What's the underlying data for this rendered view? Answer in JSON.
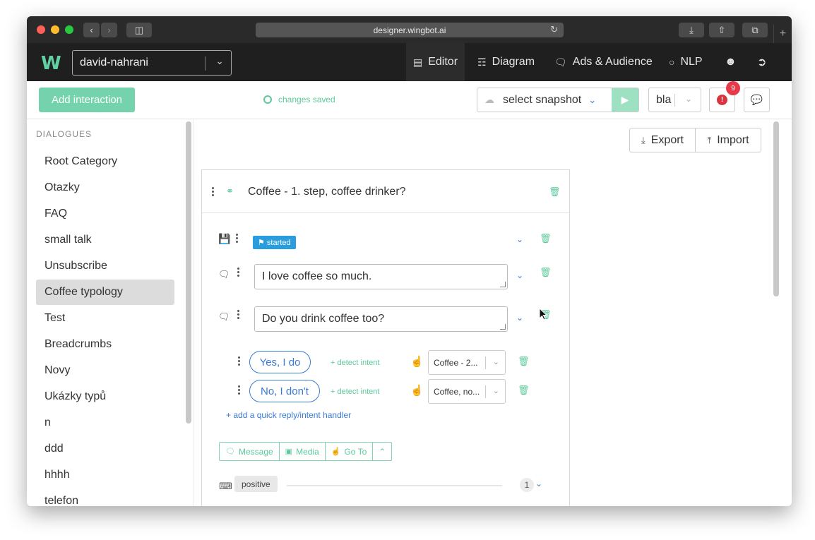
{
  "browser": {
    "url": "designer.wingbot.ai"
  },
  "header": {
    "logo": "W",
    "project": "david-nahrani",
    "nav": [
      {
        "label": "Editor",
        "icon": "list-icon"
      },
      {
        "label": "Diagram",
        "icon": "sitemap-icon"
      },
      {
        "label": "Ads & Audience",
        "icon": "comment-icon"
      },
      {
        "label": "NLP",
        "icon": "lightbulb-icon"
      }
    ]
  },
  "toolbar": {
    "add_interaction": "Add interaction",
    "status": "changes saved",
    "snapshot": "select snapshot",
    "language": "bla",
    "alert_count": "9",
    "alert_symbol": "!"
  },
  "sidebar": {
    "title": "DIALOGUES",
    "items": [
      {
        "label": "Root Category"
      },
      {
        "label": "Otazky"
      },
      {
        "label": "FAQ"
      },
      {
        "label": "small talk"
      },
      {
        "label": "Unsubscribe"
      },
      {
        "label": "Coffee typology",
        "selected": true
      },
      {
        "label": "Test"
      },
      {
        "label": "Breadcrumbs"
      },
      {
        "label": "Novy"
      },
      {
        "label": "Ukázky typů"
      },
      {
        "label": "n"
      },
      {
        "label": "ddd"
      },
      {
        "label": "hhhh"
      },
      {
        "label": "telefon"
      }
    ]
  },
  "main": {
    "export_label": "Export",
    "import_label": "Import",
    "interaction": {
      "title": "Coffee - 1. step, coffee drinker?",
      "tag": "started",
      "messages": [
        {
          "text": "I love coffee so much."
        },
        {
          "text": "Do you drink coffee too?"
        }
      ],
      "quick_replies": [
        {
          "label": "Yes, I do",
          "detect": "detect intent",
          "target": "Coffee - 2..."
        },
        {
          "label": "No, I don't",
          "detect": "detect intent",
          "target": "Coffee, no..."
        }
      ],
      "add_quick_reply": "add a quick reply/intent handler",
      "buttons": {
        "message": "Message",
        "media": "Media",
        "goto": "Go To"
      },
      "condition_label": "positive",
      "condition_count": "1"
    }
  },
  "colors": {
    "accent_green": "#5cc99b",
    "accent_blue": "#3a7bd5",
    "header_bg": "#1f1f1f",
    "alert_red": "#e8394a"
  }
}
